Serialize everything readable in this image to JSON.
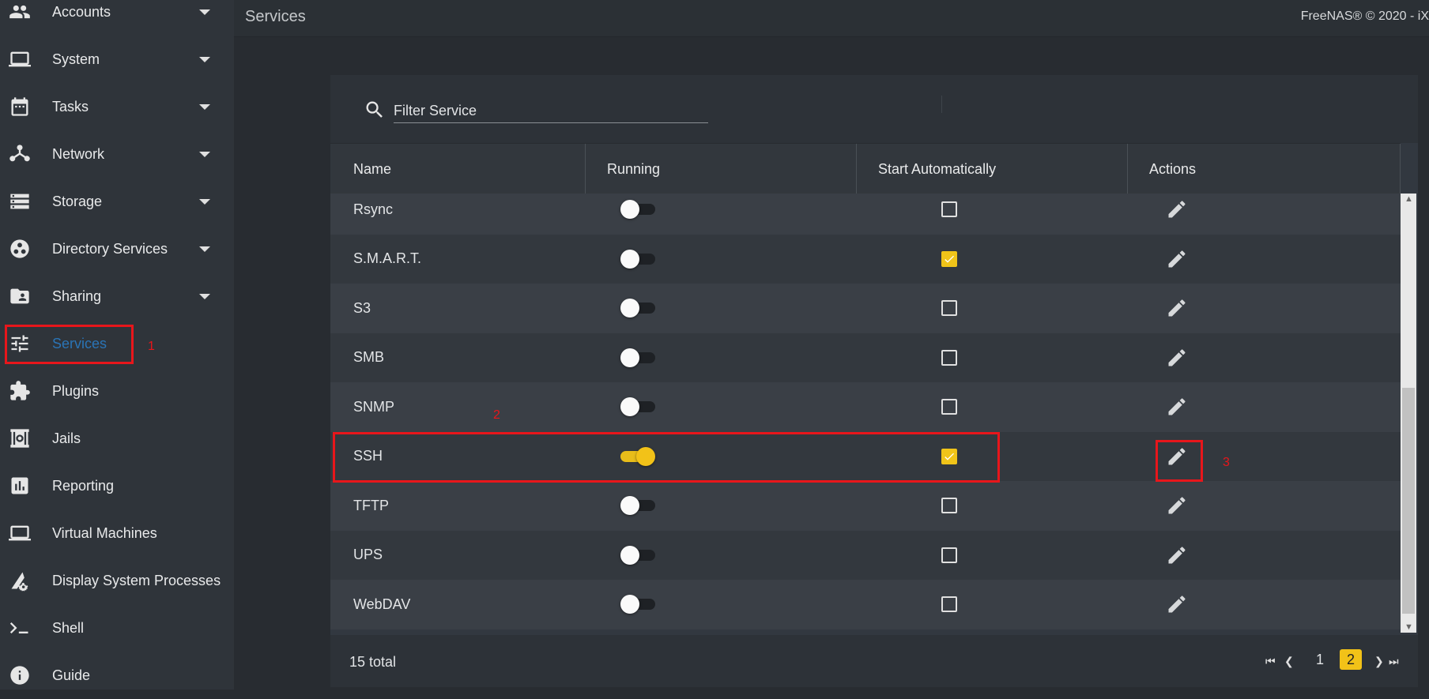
{
  "sidebar": {
    "items": [
      {
        "label": "Accounts",
        "icon": "accounts-icon",
        "has_arrow": true
      },
      {
        "label": "System",
        "icon": "laptop-icon",
        "has_arrow": true
      },
      {
        "label": "Tasks",
        "icon": "calendar-icon",
        "has_arrow": true
      },
      {
        "label": "Network",
        "icon": "network-icon",
        "has_arrow": true
      },
      {
        "label": "Storage",
        "icon": "storage-icon",
        "has_arrow": true
      },
      {
        "label": "Directory Services",
        "icon": "directory-icon",
        "has_arrow": true
      },
      {
        "label": "Sharing",
        "icon": "shared-folder-icon",
        "has_arrow": true
      },
      {
        "label": "Services",
        "icon": "tune-icon",
        "has_arrow": false,
        "active": true
      },
      {
        "label": "Plugins",
        "icon": "puzzle-icon",
        "has_arrow": false
      },
      {
        "label": "Jails",
        "icon": "jail-icon",
        "has_arrow": false
      },
      {
        "label": "Reporting",
        "icon": "chart-icon",
        "has_arrow": false
      },
      {
        "label": "Virtual Machines",
        "icon": "laptop-icon",
        "has_arrow": false
      },
      {
        "label": "Display System Processes",
        "icon": "processes-icon",
        "has_arrow": false
      },
      {
        "label": "Shell",
        "icon": "console-icon",
        "has_arrow": false
      },
      {
        "label": "Guide",
        "icon": "info-icon",
        "has_arrow": false
      }
    ]
  },
  "header": {
    "title": "Services",
    "copyright": "FreeNAS® © 2020 - iX"
  },
  "filter": {
    "placeholder": "Filter Service"
  },
  "table": {
    "columns": [
      "Name",
      "Running",
      "Start Automatically",
      "Actions"
    ],
    "rows": [
      {
        "name": "Rsync",
        "running": false,
        "auto": false
      },
      {
        "name": "S.M.A.R.T.",
        "running": false,
        "auto": true
      },
      {
        "name": "S3",
        "running": false,
        "auto": false
      },
      {
        "name": "SMB",
        "running": false,
        "auto": false
      },
      {
        "name": "SNMP",
        "running": false,
        "auto": false
      },
      {
        "name": "SSH",
        "running": true,
        "auto": true
      },
      {
        "name": "TFTP",
        "running": false,
        "auto": false
      },
      {
        "name": "UPS",
        "running": false,
        "auto": false
      },
      {
        "name": "WebDAV",
        "running": false,
        "auto": false
      }
    ]
  },
  "footer": {
    "total": "15 total",
    "pages": [
      "1",
      "2"
    ],
    "current_page": "2"
  },
  "annotations": {
    "one": "1",
    "two": "2",
    "three": "3"
  },
  "colors": {
    "accent": "#f2c218",
    "active_nav": "#2a74b6",
    "annotation": "#e8161b"
  }
}
